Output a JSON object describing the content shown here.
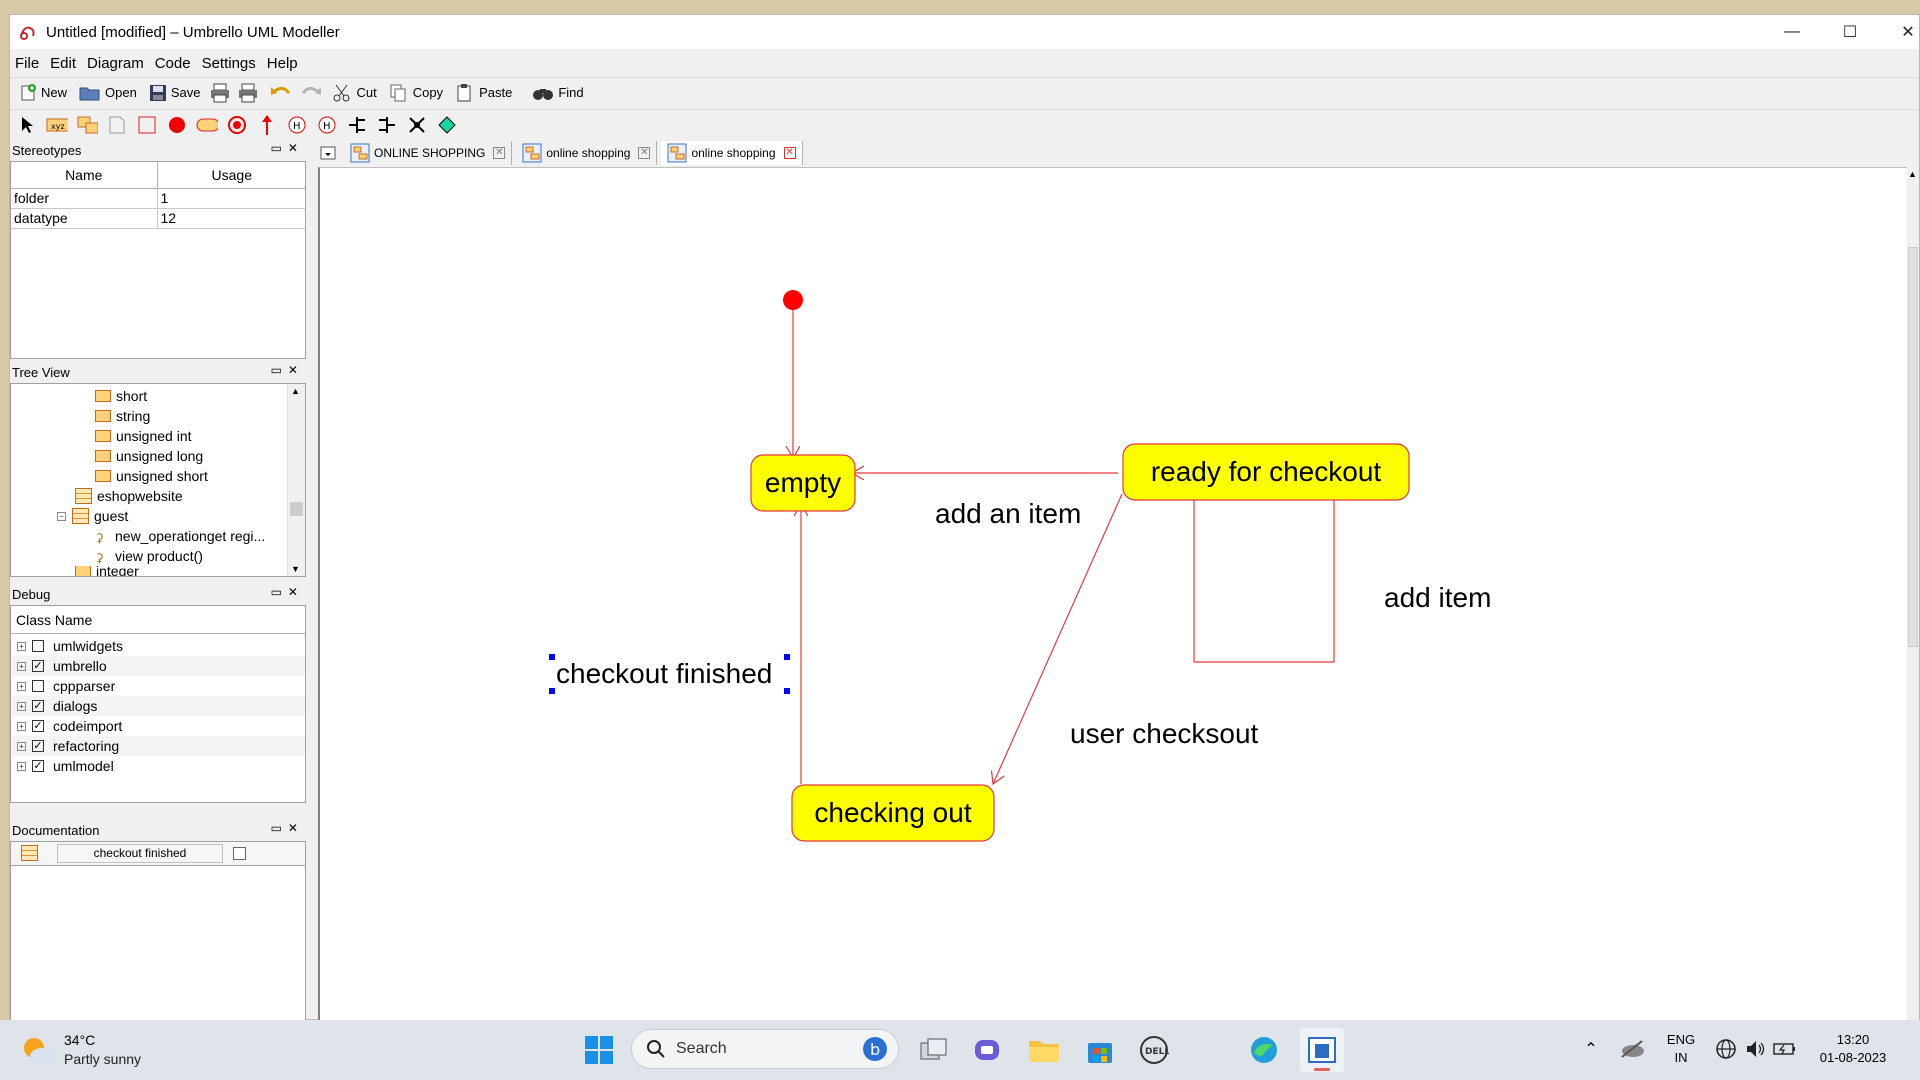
{
  "window": {
    "title": "Untitled [modified] – Umbrello UML Modeller"
  },
  "menu": [
    "File",
    "Edit",
    "Diagram",
    "Code",
    "Settings",
    "Help"
  ],
  "toolbar": {
    "new": "New",
    "open": "Open",
    "save": "Save",
    "cut": "Cut",
    "copy": "Copy",
    "paste": "Paste",
    "find": "Find"
  },
  "stereotypes": {
    "title": "Stereotypes",
    "columns": [
      "Name",
      "Usage"
    ],
    "rows": [
      {
        "name": "folder",
        "usage": "1"
      },
      {
        "name": "datatype",
        "usage": "12"
      }
    ]
  },
  "tree_view": {
    "title": "Tree View",
    "items": [
      "short",
      "string",
      "unsigned int",
      "unsigned long",
      "unsigned short",
      "eshopwebsite",
      "guest",
      "new_operationget regi...",
      "view product()",
      "integer"
    ]
  },
  "debug": {
    "title": "Debug",
    "column": "Class Name",
    "rows": [
      {
        "name": "umlwidgets",
        "checked": false
      },
      {
        "name": "umbrello",
        "checked": true
      },
      {
        "name": "cppparser",
        "checked": false
      },
      {
        "name": "dialogs",
        "checked": true
      },
      {
        "name": "codeimport",
        "checked": true
      },
      {
        "name": "refactoring",
        "checked": true
      },
      {
        "name": "umlmodel",
        "checked": true
      }
    ]
  },
  "documentation": {
    "title": "Documentation",
    "field_value": "checkout finished"
  },
  "tabs": [
    "ONLINE SHOPPING",
    "online shopping",
    "online shopping"
  ],
  "diagram": {
    "states": {
      "empty": "empty",
      "ready": "ready for checkout",
      "checking_out": "checking out"
    },
    "labels": {
      "add_an_item": "add an item",
      "add_item": "add item",
      "user_checksout": "user checksout",
      "checkout_finished": "checkout finished"
    },
    "state_fill": "#ffff00",
    "line_color": "#e8383d",
    "initial_color": "#ff0000"
  },
  "taskbar": {
    "temperature": "34°C",
    "weather": "Partly sunny",
    "search": "Search",
    "lang_top": "ENG",
    "lang_bottom": "IN",
    "time": "13:20",
    "date": "01-08-2023"
  }
}
